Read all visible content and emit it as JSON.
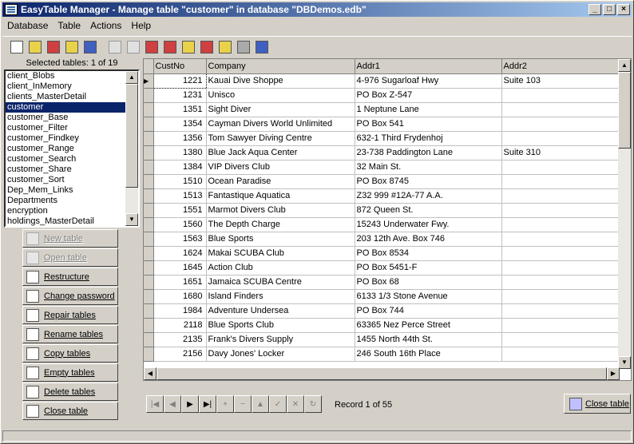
{
  "window": {
    "title": "EasyTable Manager - Manage table \"customer\" in database \"DBDemos.edb\"",
    "controls": [
      "_",
      "□",
      "×"
    ]
  },
  "menu": [
    "Database",
    "Table",
    "Actions",
    "Help"
  ],
  "toolbar_icons": [
    "new-icon",
    "open-icon",
    "restructure-icon",
    "db-icon",
    "close-icon",
    "new-table-icon",
    "open-table-icon",
    "restructure-table-icon",
    "repair-icon",
    "rename-icon",
    "copy-icon",
    "empty-icon",
    "delete-icon",
    "close-table-icon"
  ],
  "left": {
    "selected_label": "Selected tables: 1 of 19",
    "tables": [
      "client_Blobs",
      "client_InMemory",
      "clients_MasterDetail",
      "customer",
      "customer_Base",
      "customer_Filter",
      "customer_Findkey",
      "customer_Range",
      "customer_Search",
      "customer_Share",
      "customer_Sort",
      "Dep_Mem_Links",
      "Departments",
      "encryption",
      "holdings_MasterDetail"
    ],
    "selected_index": 3,
    "actions": [
      {
        "label": "New table",
        "enabled": false
      },
      {
        "label": "Open table",
        "enabled": false
      },
      {
        "label": "Restructure",
        "enabled": true
      },
      {
        "label": "Change password",
        "enabled": true
      },
      {
        "label": "Repair tables",
        "enabled": true
      },
      {
        "label": "Rename tables",
        "enabled": true
      },
      {
        "label": "Copy tables",
        "enabled": true
      },
      {
        "label": "Empty tables",
        "enabled": true
      },
      {
        "label": "Delete tables",
        "enabled": true
      },
      {
        "label": "Close table",
        "enabled": true
      }
    ]
  },
  "grid": {
    "columns": [
      "CustNo",
      "Company",
      "Addr1",
      "Addr2"
    ],
    "rows": [
      [
        "1221",
        "Kauai Dive Shoppe",
        "4-976 Sugarloaf Hwy",
        "Suite 103"
      ],
      [
        "1231",
        "Unisco",
        "PO Box Z-547",
        ""
      ],
      [
        "1351",
        "Sight Diver",
        "1 Neptune Lane",
        ""
      ],
      [
        "1354",
        "Cayman Divers World Unlimited",
        "PO Box 541",
        ""
      ],
      [
        "1356",
        "Tom Sawyer Diving Centre",
        "632-1 Third Frydenhoj",
        ""
      ],
      [
        "1380",
        "Blue Jack Aqua Center",
        "23-738 Paddington Lane",
        "Suite 310"
      ],
      [
        "1384",
        "VIP Divers Club",
        "32 Main St.",
        ""
      ],
      [
        "1510",
        "Ocean Paradise",
        "PO Box 8745",
        ""
      ],
      [
        "1513",
        "Fantastique Aquatica",
        "Z32 999 #12A-77 A.A.",
        ""
      ],
      [
        "1551",
        "Marmot Divers Club",
        "872 Queen St.",
        ""
      ],
      [
        "1560",
        "The Depth Charge",
        "15243 Underwater Fwy.",
        ""
      ],
      [
        "1563",
        "Blue Sports",
        "203 12th Ave. Box 746",
        ""
      ],
      [
        "1624",
        "Makai SCUBA Club",
        "PO Box 8534",
        ""
      ],
      [
        "1645",
        "Action Club",
        "PO Box 5451-F",
        ""
      ],
      [
        "1651",
        "Jamaica SCUBA Centre",
        "PO Box 68",
        ""
      ],
      [
        "1680",
        "Island Finders",
        "6133 1/3 Stone Avenue",
        ""
      ],
      [
        "1984",
        "Adventure Undersea",
        "PO Box 744",
        ""
      ],
      [
        "2118",
        "Blue Sports Club",
        "63365 Nez Perce Street",
        ""
      ],
      [
        "2135",
        "Frank's Divers Supply",
        "1455 North 44th St.",
        ""
      ],
      [
        "2156",
        "Davy Jones' Locker",
        "246 South 16th Place",
        ""
      ]
    ]
  },
  "navigator": {
    "buttons": [
      {
        "name": "first",
        "glyph": "|◀",
        "enabled": false
      },
      {
        "name": "prior",
        "glyph": "◀",
        "enabled": false
      },
      {
        "name": "next",
        "glyph": "▶",
        "enabled": true
      },
      {
        "name": "last",
        "glyph": "▶|",
        "enabled": true
      },
      {
        "name": "insert",
        "glyph": "+",
        "enabled": false
      },
      {
        "name": "delete",
        "glyph": "−",
        "enabled": false
      },
      {
        "name": "edit",
        "glyph": "▲",
        "enabled": false
      },
      {
        "name": "post",
        "glyph": "✓",
        "enabled": false
      },
      {
        "name": "cancel",
        "glyph": "✕",
        "enabled": false
      },
      {
        "name": "refresh",
        "glyph": "↻",
        "enabled": false
      }
    ],
    "record_text": "Record 1 of 55"
  },
  "close_table_label": "Close table"
}
